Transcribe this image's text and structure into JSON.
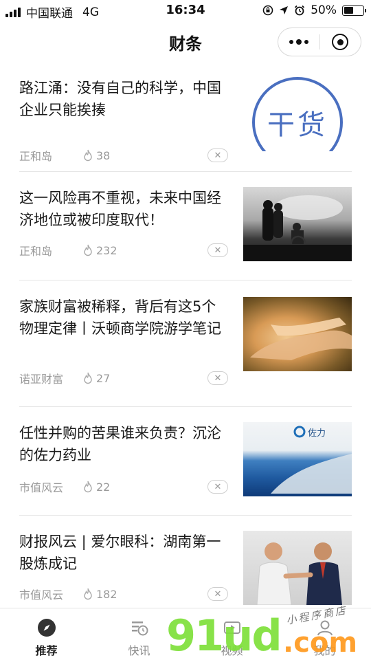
{
  "status_bar": {
    "carrier": "中国联通",
    "network": "4G",
    "time": "16:34",
    "battery": "50%",
    "battery_level": 0.5
  },
  "nav": {
    "title": "财条"
  },
  "articles": [
    {
      "title": "路江涌：没有自己的科学，中国企业只能挨揍",
      "source": "正和岛",
      "count": "38",
      "thumb_text": "干货"
    },
    {
      "title": "这一风险再不重视，未来中国经济地位或被印度取代！",
      "source": "正和岛",
      "count": "232"
    },
    {
      "title": "家族财富被稀释，背后有这5个物理定律丨沃顿商学院游学笔记",
      "source": "诺亚财富",
      "count": "27"
    },
    {
      "title": "任性并购的苦果谁来负责？沉沦的佐力药业",
      "source": "市值风云",
      "count": "22",
      "thumb_text": "佐力"
    },
    {
      "title": "财报风云 | 爱尔眼科：湖南第一股炼成记",
      "source": "市值风云",
      "count": "182"
    }
  ],
  "tabbar": {
    "tabs": [
      {
        "label": "推荐",
        "icon": "compass-icon"
      },
      {
        "label": "快讯",
        "icon": "news-clock-icon"
      },
      {
        "label": "视频",
        "icon": "video-icon"
      },
      {
        "label": "我的",
        "icon": "user-icon"
      }
    ]
  },
  "watermark": {
    "number": "91ud",
    "domain": ".com",
    "signature": "小程序商店"
  },
  "colors": {
    "accent_blue": "#4a6fc0",
    "watermark_green": "#7ee03a",
    "watermark_orange": "#ff9a1e"
  }
}
